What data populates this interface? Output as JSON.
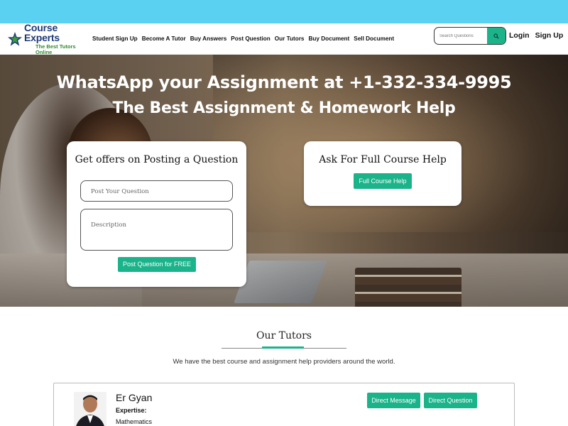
{
  "brand": {
    "title": "Course Experts",
    "tagline": "The Best Tutors Online"
  },
  "nav": {
    "links": [
      "Student Sign Up",
      "Become A Tutor",
      "Buy Answers",
      "Post Question",
      "Our Tutors",
      "Buy Document",
      "Sell Document"
    ],
    "search_placeholder": "Search Questions",
    "login": "Login",
    "signup": "Sign Up"
  },
  "hero": {
    "line1": "WhatsApp your Assignment at +1-332-334-9995",
    "line2": "The Best Assignment & Homework Help"
  },
  "post_card": {
    "title": "Get offers on Posting a Question",
    "question_placeholder": "Post Your Question",
    "description_placeholder": "Description",
    "button": "Post Question for FREE"
  },
  "course_card": {
    "title": "Ask For Full Course Help",
    "button": "Full Course Help"
  },
  "tutors": {
    "title": "Our Tutors",
    "subtitle": "We have the best course and assignment help providers around the world.",
    "items": [
      {
        "name": "Er Gyan",
        "expertise_label": "Expertise:",
        "expertise": "Mathematics",
        "message_button": "Direct Message",
        "question_button": "Direct Question"
      }
    ]
  },
  "colors": {
    "topbar": "#5ad1f0",
    "accent": "#1ab38a",
    "brand_blue": "#1e3a78",
    "brand_green": "#2e8b2e"
  },
  "icons": {
    "logo": "star-logo-icon",
    "search": "search-icon"
  }
}
